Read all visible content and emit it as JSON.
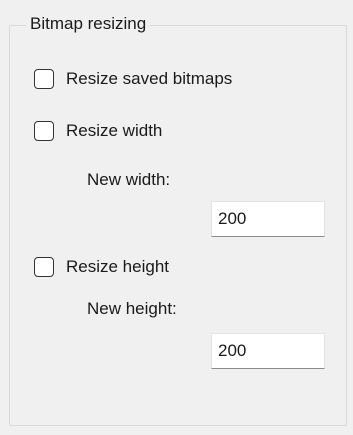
{
  "group": {
    "title": "Bitmap resizing"
  },
  "options": {
    "resize_saved": {
      "label": "Resize saved bitmaps",
      "checked": false
    },
    "resize_width": {
      "label": "Resize width",
      "checked": false,
      "field_label": "New width:",
      "value": "200"
    },
    "resize_height": {
      "label": "Resize height",
      "checked": false,
      "field_label": "New height:",
      "value": "200"
    }
  }
}
